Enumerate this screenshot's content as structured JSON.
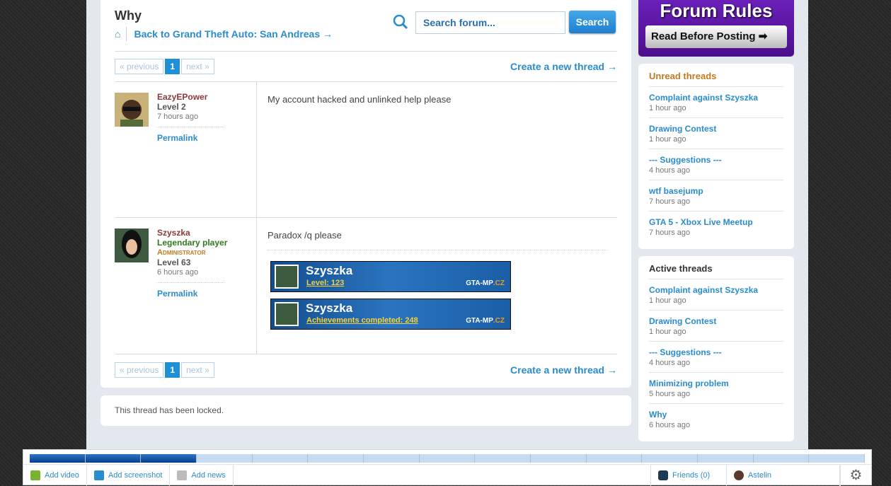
{
  "thread": {
    "title": "Why",
    "back_label": "Back to Grand Theft Auto: San Andreas",
    "locked_text": "This thread has been locked."
  },
  "search": {
    "placeholder": "Search forum...",
    "button": "Search"
  },
  "pager": {
    "previous": "« previous",
    "current": "1",
    "next": "next »",
    "create": "Create a new thread"
  },
  "posts": [
    {
      "author": "EazyEPower",
      "level": "Level 2",
      "time": "7 hours ago",
      "permalink": "Permalink",
      "body": "My account hacked and unlinked help please"
    },
    {
      "author": "Szyszka",
      "rank": "Legendary player",
      "role": "Administrator",
      "level": "Level 63",
      "time": "6 hours ago",
      "permalink": "Permalink",
      "body": "Paradox /q please",
      "signatures": [
        {
          "name": "Szyszka",
          "line": "Level: 123",
          "logo": "GTA-MP",
          "logo_tld": ".CZ"
        },
        {
          "name": "Szyszka",
          "line": "Achievements completed: 248",
          "logo": "GTA-MP",
          "logo_tld": ".CZ"
        }
      ]
    }
  ],
  "sidebar": {
    "rules": {
      "title": "Forum Rules",
      "button": "Read Before Posting"
    },
    "unread": {
      "title": "Unread threads",
      "items": [
        {
          "title": "Complaint against Szyszka",
          "time": "1 hour ago"
        },
        {
          "title": "Drawing Contest",
          "time": "1 hour ago"
        },
        {
          "title": "--- Suggestions ---",
          "time": "4 hours ago"
        },
        {
          "title": "wtf basejump",
          "time": "7 hours ago"
        },
        {
          "title": "GTA 5 - Xbox Live Meetup",
          "time": "7 hours ago"
        }
      ]
    },
    "active": {
      "title": "Active threads",
      "items": [
        {
          "title": "Complaint against Szyszka",
          "time": "1 hour ago"
        },
        {
          "title": "Drawing Contest",
          "time": "1 hour ago"
        },
        {
          "title": "--- Suggestions ---",
          "time": "4 hours ago"
        },
        {
          "title": "Minimizing problem",
          "time": "5 hours ago"
        },
        {
          "title": "Why",
          "time": "6 hours ago"
        }
      ]
    }
  },
  "bottombar": {
    "progress_fraction": 0.2,
    "add_video": "Add video",
    "add_screenshot": "Add screenshot",
    "add_news": "Add news",
    "friends": "Friends (0)",
    "user": "Astelin",
    "settings_icon": "gear-icon"
  },
  "colors": {
    "accent": "#2a8ccd",
    "unread_title": "#c07a20",
    "author": "#8b3a3a",
    "rank": "#2f7a1e",
    "admin": "#c07a20"
  }
}
